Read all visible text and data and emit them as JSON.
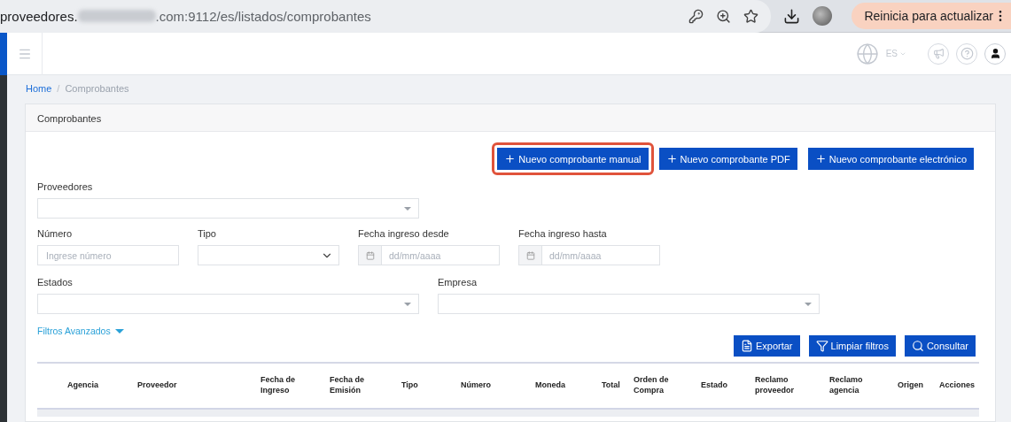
{
  "browser": {
    "url_start": "proveedores.",
    "url_end": ".com:9112/es/listados/comprobantes",
    "update_button": "Reinicia para actualizar"
  },
  "header": {
    "language": "ES"
  },
  "breadcrumb": {
    "separator": "/",
    "items": [
      {
        "label": "Home",
        "kind": "link"
      },
      {
        "label": "Comprobantes",
        "kind": "current"
      }
    ]
  },
  "card": {
    "title": "Comprobantes",
    "actions": [
      {
        "label": "Nuevo comprobante manual",
        "highlighted": true
      },
      {
        "label": "Nuevo comprobante PDF",
        "highlighted": false
      },
      {
        "label": "Nuevo comprobante electrónico",
        "highlighted": false
      }
    ],
    "filter_rows": [
      [
        {
          "label": "Proveedores",
          "kind": "combo"
        }
      ],
      [
        {
          "label": "Número",
          "kind": "text",
          "placeholder": "Ingrese número"
        },
        {
          "label": "Tipo",
          "kind": "select"
        },
        {
          "label": "Fecha ingreso desde",
          "kind": "date",
          "placeholder": "dd/mm/aaaa"
        },
        {
          "label": "Fecha ingreso hasta",
          "kind": "date",
          "placeholder": "dd/mm/aaaa"
        }
      ],
      [
        {
          "label": "Estados",
          "kind": "combo"
        },
        {
          "label": "Empresa",
          "kind": "combo"
        }
      ]
    ],
    "advanced_filters": {
      "label": "Filtros Avanzados",
      "expanded": false
    },
    "table_buttons": [
      {
        "label": "Exportar",
        "kind": "export"
      },
      {
        "label": "Limpiar filtros",
        "kind": "filter"
      },
      {
        "label": "Consultar",
        "kind": "search"
      }
    ],
    "table": {
      "columns": [
        "Agencia",
        "Proveedor",
        "Fecha de Ingreso",
        "Fecha de Emisión",
        "Tipo",
        "Número",
        "Moneda",
        "Total",
        "Orden de Compra",
        "Estado",
        "Reclamo proveedor",
        "Reclamo agencia",
        "Origen",
        "Acciones"
      ]
    }
  }
}
